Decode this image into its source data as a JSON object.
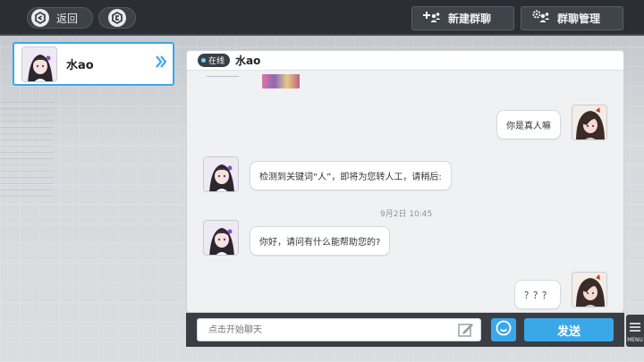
{
  "topbar": {
    "back_label": "返回",
    "new_group_label": "新建群聊",
    "group_manage_label": "群聊管理"
  },
  "contacts": [
    {
      "name": "水ao",
      "selected": true
    }
  ],
  "chat": {
    "status": "在线",
    "title": "水ao",
    "messages": [
      {
        "from": "self",
        "text": "你是真人嘛"
      },
      {
        "from": "other",
        "text": "检测到关键词“人”，即将为您转人工，请稍后:"
      },
      {
        "type": "timestamp",
        "text": "9月2日 10:45"
      },
      {
        "from": "other",
        "text": "你好，请问有什么能帮助您的?"
      },
      {
        "from": "self",
        "text": "？？？"
      }
    ]
  },
  "input": {
    "placeholder": "点击开始聊天",
    "send_label": "发送"
  },
  "menu": {
    "label": "MENU"
  },
  "colors": {
    "accent": "#3aa8e8",
    "topbar": "#2b2f35",
    "online_dot": "#6fd3ff"
  }
}
